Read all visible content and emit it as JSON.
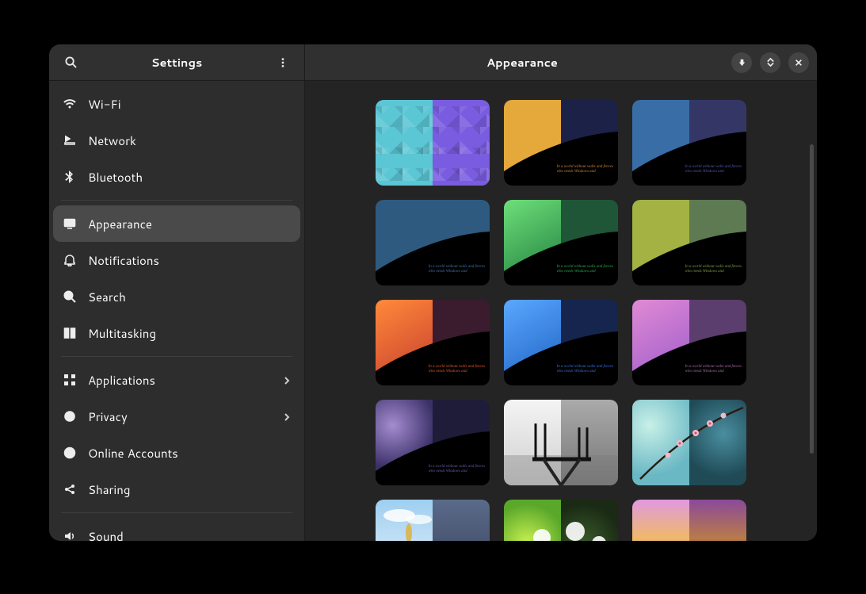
{
  "sidebar": {
    "title": "Settings",
    "items": [
      {
        "icon": "wifi",
        "label": "Wi-Fi",
        "submenu": false
      },
      {
        "icon": "network",
        "label": "Network",
        "submenu": false
      },
      {
        "icon": "bluetooth",
        "label": "Bluetooth",
        "submenu": false
      },
      {
        "sep": true
      },
      {
        "icon": "display",
        "label": "Appearance",
        "submenu": false,
        "active": true
      },
      {
        "icon": "bell",
        "label": "Notifications",
        "submenu": false
      },
      {
        "icon": "search",
        "label": "Search",
        "submenu": false
      },
      {
        "icon": "multitask",
        "label": "Multitasking",
        "submenu": false
      },
      {
        "sep": true
      },
      {
        "icon": "apps",
        "label": "Applications",
        "submenu": true
      },
      {
        "icon": "privacy",
        "label": "Privacy",
        "submenu": true
      },
      {
        "icon": "at",
        "label": "Online Accounts",
        "submenu": false
      },
      {
        "icon": "share",
        "label": "Sharing",
        "submenu": false
      },
      {
        "sep": true
      },
      {
        "icon": "sound",
        "label": "Sound",
        "submenu": false
      }
    ]
  },
  "main": {
    "title": "Appearance",
    "quote_line1": "In a world without walls and fences",
    "quote_line2": "who needs Windows and",
    "wallpapers": [
      {
        "name": "geometric-cyan-purple",
        "kind": "geo",
        "left": "#5bc6d4",
        "right": "#7a5ce0",
        "txt": null
      },
      {
        "name": "hill-amber-navy",
        "kind": "hill",
        "left": "#e4a93a",
        "right": "#1c2247",
        "txt": "#c4833d"
      },
      {
        "name": "hill-blue-indigo",
        "kind": "hill",
        "left": "#396da6",
        "right": "#343766",
        "txt": "#4e5ab0"
      },
      {
        "name": "hill-steelblue-plain",
        "kind": "hill",
        "left": "#2f5a80",
        "right": "#2f5a80",
        "txt": "#4671a0"
      },
      {
        "name": "hill-green-emerald",
        "kind": "hill",
        "left": "linear-gradient(150deg,#6ee07a,#1d7a3c)",
        "right": "#1f5638",
        "txt": "#2aa94f"
      },
      {
        "name": "hill-olive-sage",
        "kind": "hill",
        "left": "#a3b243",
        "right": "#5e7a52",
        "txt": "#7f9b48"
      },
      {
        "name": "hill-orange-maroon",
        "kind": "hill",
        "left": "linear-gradient(150deg,#ff8a3a,#c43a2e)",
        "right": "#3a1c2e",
        "txt": "#d95a2e"
      },
      {
        "name": "hill-skyblue-navy",
        "kind": "hill",
        "left": "linear-gradient(150deg,#5aa8ff,#1c5fc0)",
        "right": "#16254d",
        "txt": "#3a6fd4"
      },
      {
        "name": "hill-pink-violet",
        "kind": "hill",
        "left": "linear-gradient(150deg,#e08ad4,#9a5acc)",
        "right": "#5c3e6e",
        "txt": "#a46aa6"
      },
      {
        "name": "milkyway-night",
        "kind": "hill",
        "left": "radial-gradient(circle at 30% 30%, #a48cd0, #3a2f66 60%)",
        "right": "#1e1c38",
        "txt": "#6a5a9e"
      },
      {
        "name": "dock-bw",
        "kind": "photo-bw"
      },
      {
        "name": "cherry-blossom",
        "kind": "photo-blossom"
      },
      {
        "name": "wheat-sky",
        "kind": "photo-wheat"
      },
      {
        "name": "dandelion-green",
        "kind": "photo-dandelion"
      },
      {
        "name": "sunset-figure",
        "kind": "photo-sunset"
      }
    ]
  }
}
